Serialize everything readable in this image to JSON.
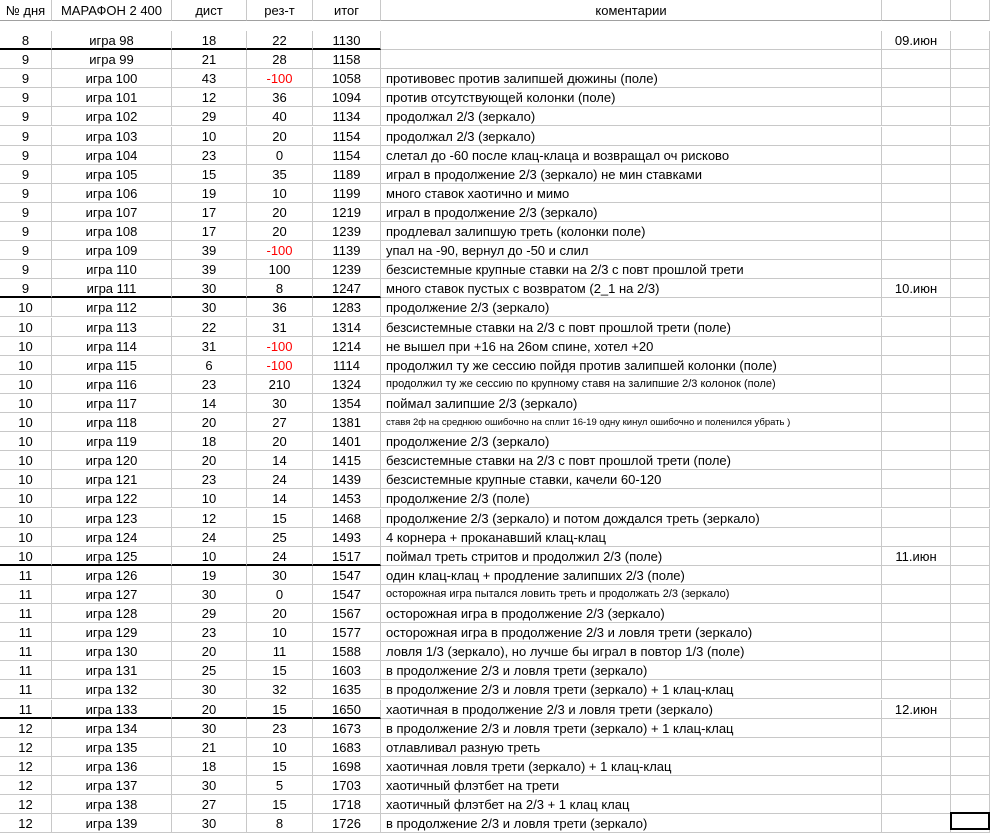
{
  "header": {
    "day": "№ дня",
    "marathon": "МАРАФОН 2 400",
    "dist": "дист",
    "result": "рез-т",
    "total": "итог",
    "comments": "коментарии"
  },
  "rows": [
    {
      "day": "8",
      "game": "игра 98",
      "dist": "18",
      "res": "22",
      "total": "1130",
      "comment": "",
      "date": "09.июн"
    },
    {
      "day": "9",
      "game": "игра 99",
      "dist": "21",
      "res": "28",
      "total": "1158",
      "comment": "",
      "date": ""
    },
    {
      "day": "9",
      "game": "игра 100",
      "dist": "43",
      "res": "-100",
      "total": "1058",
      "comment": "противовес против залипшей дюжины (поле)",
      "date": ""
    },
    {
      "day": "9",
      "game": "игра 101",
      "dist": "12",
      "res": "36",
      "total": "1094",
      "comment": "против отсутствующей колонки (поле)",
      "date": ""
    },
    {
      "day": "9",
      "game": "игра 102",
      "dist": "29",
      "res": "40",
      "total": "1134",
      "comment": "продолжал 2/3 (зеркало)",
      "date": ""
    },
    {
      "day": "9",
      "game": "игра 103",
      "dist": "10",
      "res": "20",
      "total": "1154",
      "comment": "продолжал 2/3 (зеркало)",
      "date": ""
    },
    {
      "day": "9",
      "game": "игра 104",
      "dist": "23",
      "res": "0",
      "total": "1154",
      "comment": "слетал до -60 после клац-клаца и возвращал оч рисково",
      "date": ""
    },
    {
      "day": "9",
      "game": "игра 105",
      "dist": "15",
      "res": "35",
      "total": "1189",
      "comment": "играл в продолжение 2/3 (зеркало) не мин ставками",
      "date": ""
    },
    {
      "day": "9",
      "game": "игра 106",
      "dist": "19",
      "res": "10",
      "total": "1199",
      "comment": "много ставок хаотично и мимо",
      "date": ""
    },
    {
      "day": "9",
      "game": "игра 107",
      "dist": "17",
      "res": "20",
      "total": "1219",
      "comment": "играл в продолжение 2/3 (зеркало)",
      "date": ""
    },
    {
      "day": "9",
      "game": "игра 108",
      "dist": "17",
      "res": "20",
      "total": "1239",
      "comment": "продлевал залипшую треть (колонки поле)",
      "date": ""
    },
    {
      "day": "9",
      "game": "игра 109",
      "dist": "39",
      "res": "-100",
      "total": "1139",
      "comment": "упал на -90, вернул до -50 и слил",
      "date": ""
    },
    {
      "day": "9",
      "game": "игра 110",
      "dist": "39",
      "res": "100",
      "total": "1239",
      "comment": "безсистемные крупные ставки на 2/3 с повт прошлой трети",
      "date": ""
    },
    {
      "day": "9",
      "game": "игра 111",
      "dist": "30",
      "res": "8",
      "total": "1247",
      "comment": "много ставок пустых с возвратом (2_1 на 2/3)",
      "date": "10.июн"
    },
    {
      "day": "10",
      "game": "игра 112",
      "dist": "30",
      "res": "36",
      "total": "1283",
      "comment": "продолжение 2/3 (зеркало)",
      "date": ""
    },
    {
      "day": "10",
      "game": "игра 113",
      "dist": "22",
      "res": "31",
      "total": "1314",
      "comment": "безсистемные ставки на 2/3 с повт прошлой трети (поле)",
      "date": ""
    },
    {
      "day": "10",
      "game": "игра 114",
      "dist": "31",
      "res": "-100",
      "total": "1214",
      "comment": "не вышел при +16 на 26ом спине, хотел +20",
      "date": ""
    },
    {
      "day": "10",
      "game": "игра 115",
      "dist": "6",
      "res": "-100",
      "total": "1114",
      "comment": "продолжил ту же сессию пойдя против залипшей колонки (поле)",
      "date": ""
    },
    {
      "day": "10",
      "game": "игра 116",
      "dist": "23",
      "res": "210",
      "total": "1324",
      "comment": "продолжил ту же сессию по крупному ставя на залипшие 2/3 колонок (поле)",
      "date": ""
    },
    {
      "day": "10",
      "game": "игра 117",
      "dist": "14",
      "res": "30",
      "total": "1354",
      "comment": "поймал залипшие 2/3 (зеркало)",
      "date": ""
    },
    {
      "day": "10",
      "game": "игра 118",
      "dist": "20",
      "res": "27",
      "total": "1381",
      "comment": "ставя 2ф на среднюю ошибочно на сплит 16-19 одну кинул ошибочно и поленился убрать )",
      "date": ""
    },
    {
      "day": "10",
      "game": "игра 119",
      "dist": "18",
      "res": "20",
      "total": "1401",
      "comment": "продолжение 2/3 (зеркало)",
      "date": ""
    },
    {
      "day": "10",
      "game": "игра 120",
      "dist": "20",
      "res": "14",
      "total": "1415",
      "comment": "безсистемные ставки на 2/3 с повт прошлой трети (поле)",
      "date": ""
    },
    {
      "day": "10",
      "game": "игра 121",
      "dist": "23",
      "res": "24",
      "total": "1439",
      "comment": "безсистемные крупные ставки, качели 60-120",
      "date": ""
    },
    {
      "day": "10",
      "game": "игра 122",
      "dist": "10",
      "res": "14",
      "total": "1453",
      "comment": "продолжение 2/3 (поле)",
      "date": ""
    },
    {
      "day": "10",
      "game": "игра 123",
      "dist": "12",
      "res": "15",
      "total": "1468",
      "comment": "продолжение 2/3 (зеркало) и потом дождался треть (зеркало)",
      "date": ""
    },
    {
      "day": "10",
      "game": "игра 124",
      "dist": "24",
      "res": "25",
      "total": "1493",
      "comment": "4 корнера + проканавший клац-клац",
      "date": ""
    },
    {
      "day": "10",
      "game": "игра 125",
      "dist": "10",
      "res": "24",
      "total": "1517",
      "comment": "поймал треть стритов и продолжил 2/3 (поле)",
      "date": "11.июн"
    },
    {
      "day": "11",
      "game": "игра 126",
      "dist": "19",
      "res": "30",
      "total": "1547",
      "comment": "один клац-клац + продление залипших 2/3 (поле)",
      "date": ""
    },
    {
      "day": "11",
      "game": "игра 127",
      "dist": "30",
      "res": "0",
      "total": "1547",
      "comment": "осторожная игра пытался ловить треть и продолжать 2/3 (зеркало)",
      "date": ""
    },
    {
      "day": "11",
      "game": "игра 128",
      "dist": "29",
      "res": "20",
      "total": "1567",
      "comment": "осторожная игра в продолжение 2/3 (зеркало)",
      "date": ""
    },
    {
      "day": "11",
      "game": "игра 129",
      "dist": "23",
      "res": "10",
      "total": "1577",
      "comment": "осторожная игра в продолжение 2/3 и ловля трети (зеркало)",
      "date": ""
    },
    {
      "day": "11",
      "game": "игра 130",
      "dist": "20",
      "res": "11",
      "total": "1588",
      "comment": "ловля 1/3 (зеркало), но лучше бы играл в повтор 1/3 (поле)",
      "date": ""
    },
    {
      "day": "11",
      "game": "игра 131",
      "dist": "25",
      "res": "15",
      "total": "1603",
      "comment": "в продолжение 2/3 и ловля трети (зеркало)",
      "date": ""
    },
    {
      "day": "11",
      "game": "игра 132",
      "dist": "30",
      "res": "32",
      "total": "1635",
      "comment": "в продолжение 2/3 и ловля трети (зеркало) + 1 клац-клац",
      "date": ""
    },
    {
      "day": "11",
      "game": "игра 133",
      "dist": "20",
      "res": "15",
      "total": "1650",
      "comment": "хаотичная в продолжение 2/3 и ловля трети (зеркало)",
      "date": "12.июн"
    },
    {
      "day": "12",
      "game": "игра 134",
      "dist": "30",
      "res": "23",
      "total": "1673",
      "comment": "в продолжение 2/3 и ловля трети (зеркало) + 1 клац-клац",
      "date": ""
    },
    {
      "day": "12",
      "game": "игра 135",
      "dist": "21",
      "res": "10",
      "total": "1683",
      "comment": "отлавливал разную треть",
      "date": ""
    },
    {
      "day": "12",
      "game": "игра 136",
      "dist": "18",
      "res": "15",
      "total": "1698",
      "comment": "хаотичная  ловля трети (зеркало) + 1 клац-клац",
      "date": ""
    },
    {
      "day": "12",
      "game": "игра 137",
      "dist": "30",
      "res": "5",
      "total": "1703",
      "comment": "хаотичный флэтбет на трети",
      "date": ""
    },
    {
      "day": "12",
      "game": "игра 138",
      "dist": "27",
      "res": "15",
      "total": "1718",
      "comment": "хаотичный флэтбет на 2/3 + 1 клац клац",
      "date": ""
    },
    {
      "day": "12",
      "game": "игра 139",
      "dist": "30",
      "res": "8",
      "total": "1726",
      "comment": "в продолжение 2/3 и ловля трети (зеркало)",
      "date": ""
    }
  ],
  "colors": {
    "negative": "#ff0000",
    "grid": "#c8c8c8"
  }
}
